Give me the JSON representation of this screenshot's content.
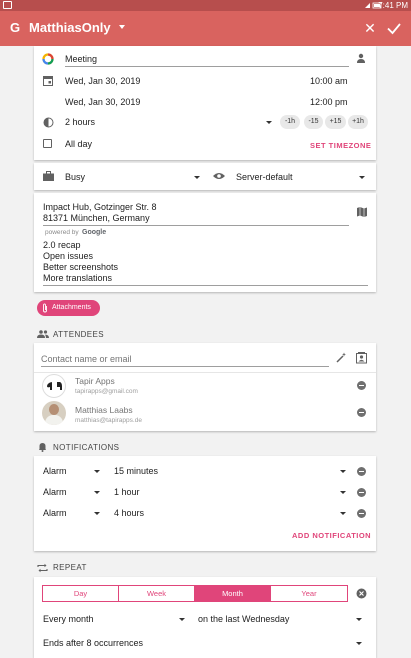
{
  "status_bar": {
    "time": "7:41 PM"
  },
  "app_bar": {
    "account_name": "MatthiasOnly"
  },
  "event": {
    "title": "Meeting",
    "start_date": "Wed, Jan 30, 2019",
    "start_time": "10:00 am",
    "end_date": "Wed, Jan 30, 2019",
    "end_time": "12:00 pm",
    "duration": "2 hours",
    "adjust_buttons": [
      "-1h",
      "-15",
      "+15",
      "+1h"
    ],
    "all_day_label": "All day",
    "set_timezone_label": "SET TIMEZONE",
    "availability": "Busy",
    "visibility": "Server-default",
    "location_line1": "Impact Hub, Gotzinger Str. 8",
    "location_line2": "81371 München, Germany",
    "powered_by": "powered by",
    "google_label": "Google",
    "description": [
      "2.0 recap",
      "Open issues",
      "Better screenshots",
      "More translations"
    ]
  },
  "attachments_label": "Attachments",
  "attendees": {
    "section_title": "ATTENDEES",
    "input_placeholder": "Contact name or email",
    "list": [
      {
        "name": "Tapir Apps",
        "email": "tapirapps@gmail.com"
      },
      {
        "name": "Matthias Laabs",
        "email": "matthias@tapirapps.de"
      }
    ]
  },
  "notifications": {
    "section_title": "NOTIFICATIONS",
    "items": [
      {
        "type": "Alarm",
        "time": "15 minutes"
      },
      {
        "type": "Alarm",
        "time": "1 hour"
      },
      {
        "type": "Alarm",
        "time": "4 hours"
      }
    ],
    "add_label": "ADD NOTIFICATION"
  },
  "repeat": {
    "section_title": "REPEAT",
    "tabs": [
      "Day",
      "Week",
      "Month",
      "Year"
    ],
    "active_tab": "Month",
    "frequency": "Every month",
    "rule": "on the last Wednesday",
    "ends": "Ends after 8 occurrences"
  },
  "colors": {
    "accent": "#e0457a",
    "app_bar": "#d9635f",
    "status_bar": "#b74e4d"
  }
}
